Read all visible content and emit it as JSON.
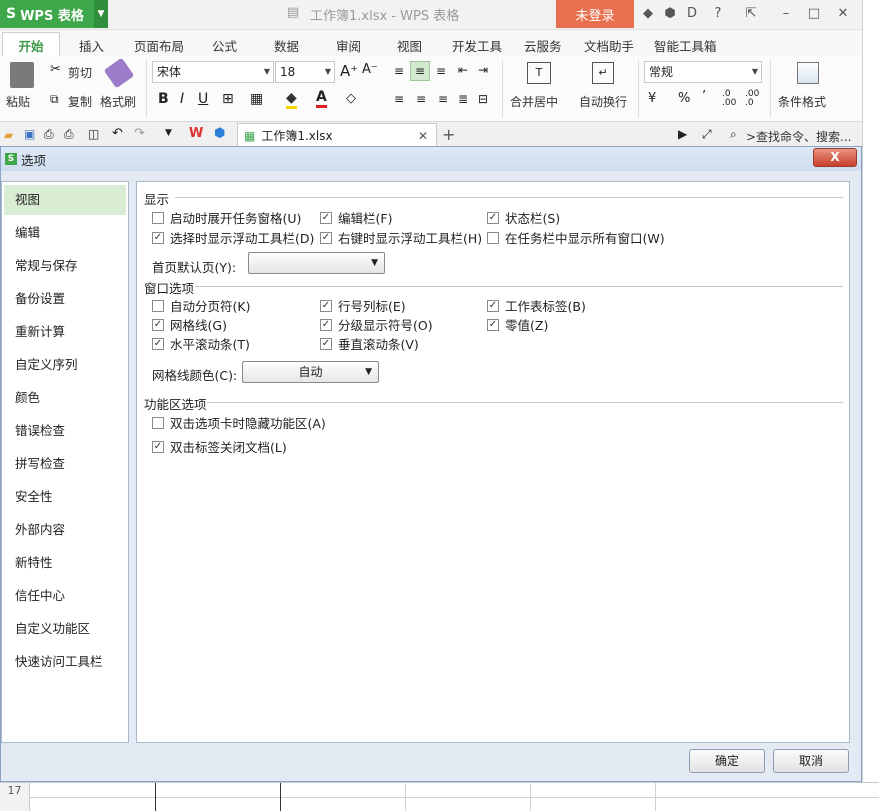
{
  "titlebar": {
    "app_name": "WPS 表格",
    "doc_title": "工作簿1.xlsx - WPS 表格",
    "login_label": "未登录"
  },
  "tabs": [
    "开始",
    "插入",
    "页面布局",
    "公式",
    "数据",
    "审阅",
    "视图",
    "开发工具",
    "云服务",
    "文档助手",
    "智能工具箱"
  ],
  "ribbon": {
    "paste_label": "粘贴",
    "cut_label": "剪切",
    "copy_label": "复制",
    "format_painter_label": "格式刷",
    "font_name": "宋体",
    "font_size": "18",
    "merge_center_label": "合并居中",
    "wrap_label": "自动换行",
    "number_format": "常规",
    "conditional_label": "条件格式"
  },
  "docbar": {
    "doc_tab_label": "工作簿1.xlsx",
    "search_placeholder": ">查找命令、搜索..."
  },
  "dialog": {
    "title": "选项",
    "close_label": "X",
    "nav": [
      "视图",
      "编辑",
      "常规与保存",
      "备份设置",
      "重新计算",
      "自定义序列",
      "颜色",
      "错误检查",
      "拼写检查",
      "安全性",
      "外部内容",
      "新特性",
      "信任中心",
      "自定义功能区",
      "快速访问工具栏"
    ],
    "sections": {
      "display": "显示",
      "window_options": "窗口选项",
      "ribbon_options": "功能区选项"
    },
    "display_options": [
      {
        "label": "启动时展开任务窗格(U)",
        "checked": false
      },
      {
        "label": "编辑栏(F)",
        "checked": true
      },
      {
        "label": "状态栏(S)",
        "checked": true
      },
      {
        "label": "选择时显示浮动工具栏(D)",
        "checked": true
      },
      {
        "label": "右键时显示浮动工具栏(H)",
        "checked": true
      },
      {
        "label": "在任务栏中显示所有窗口(W)",
        "checked": false
      }
    ],
    "homepage_label": "首页默认页(Y):",
    "homepage_value": "",
    "window_opts": [
      {
        "label": "自动分页符(K)",
        "checked": false
      },
      {
        "label": "行号列标(E)",
        "checked": true
      },
      {
        "label": "工作表标签(B)",
        "checked": true
      },
      {
        "label": "网格线(G)",
        "checked": true
      },
      {
        "label": "分级显示符号(O)",
        "checked": true
      },
      {
        "label": "零值(Z)",
        "checked": true
      },
      {
        "label": "水平滚动条(T)",
        "checked": true
      },
      {
        "label": "垂直滚动条(V)",
        "checked": true
      }
    ],
    "gridcolor_label": "网格线颜色(C):",
    "gridcolor_value": "自动",
    "ribbon_opts": [
      {
        "label": "双击选项卡时隐藏功能区(A)",
        "checked": false
      },
      {
        "label": "双击标签关闭文档(L)",
        "checked": true
      }
    ],
    "ok_label": "确定",
    "cancel_label": "取消"
  },
  "sheet": {
    "row_number": "17"
  },
  "colors": {
    "brand_green": "#3ea74a",
    "login_orange": "#e8704e",
    "nav_active": "#d9ecd4"
  }
}
